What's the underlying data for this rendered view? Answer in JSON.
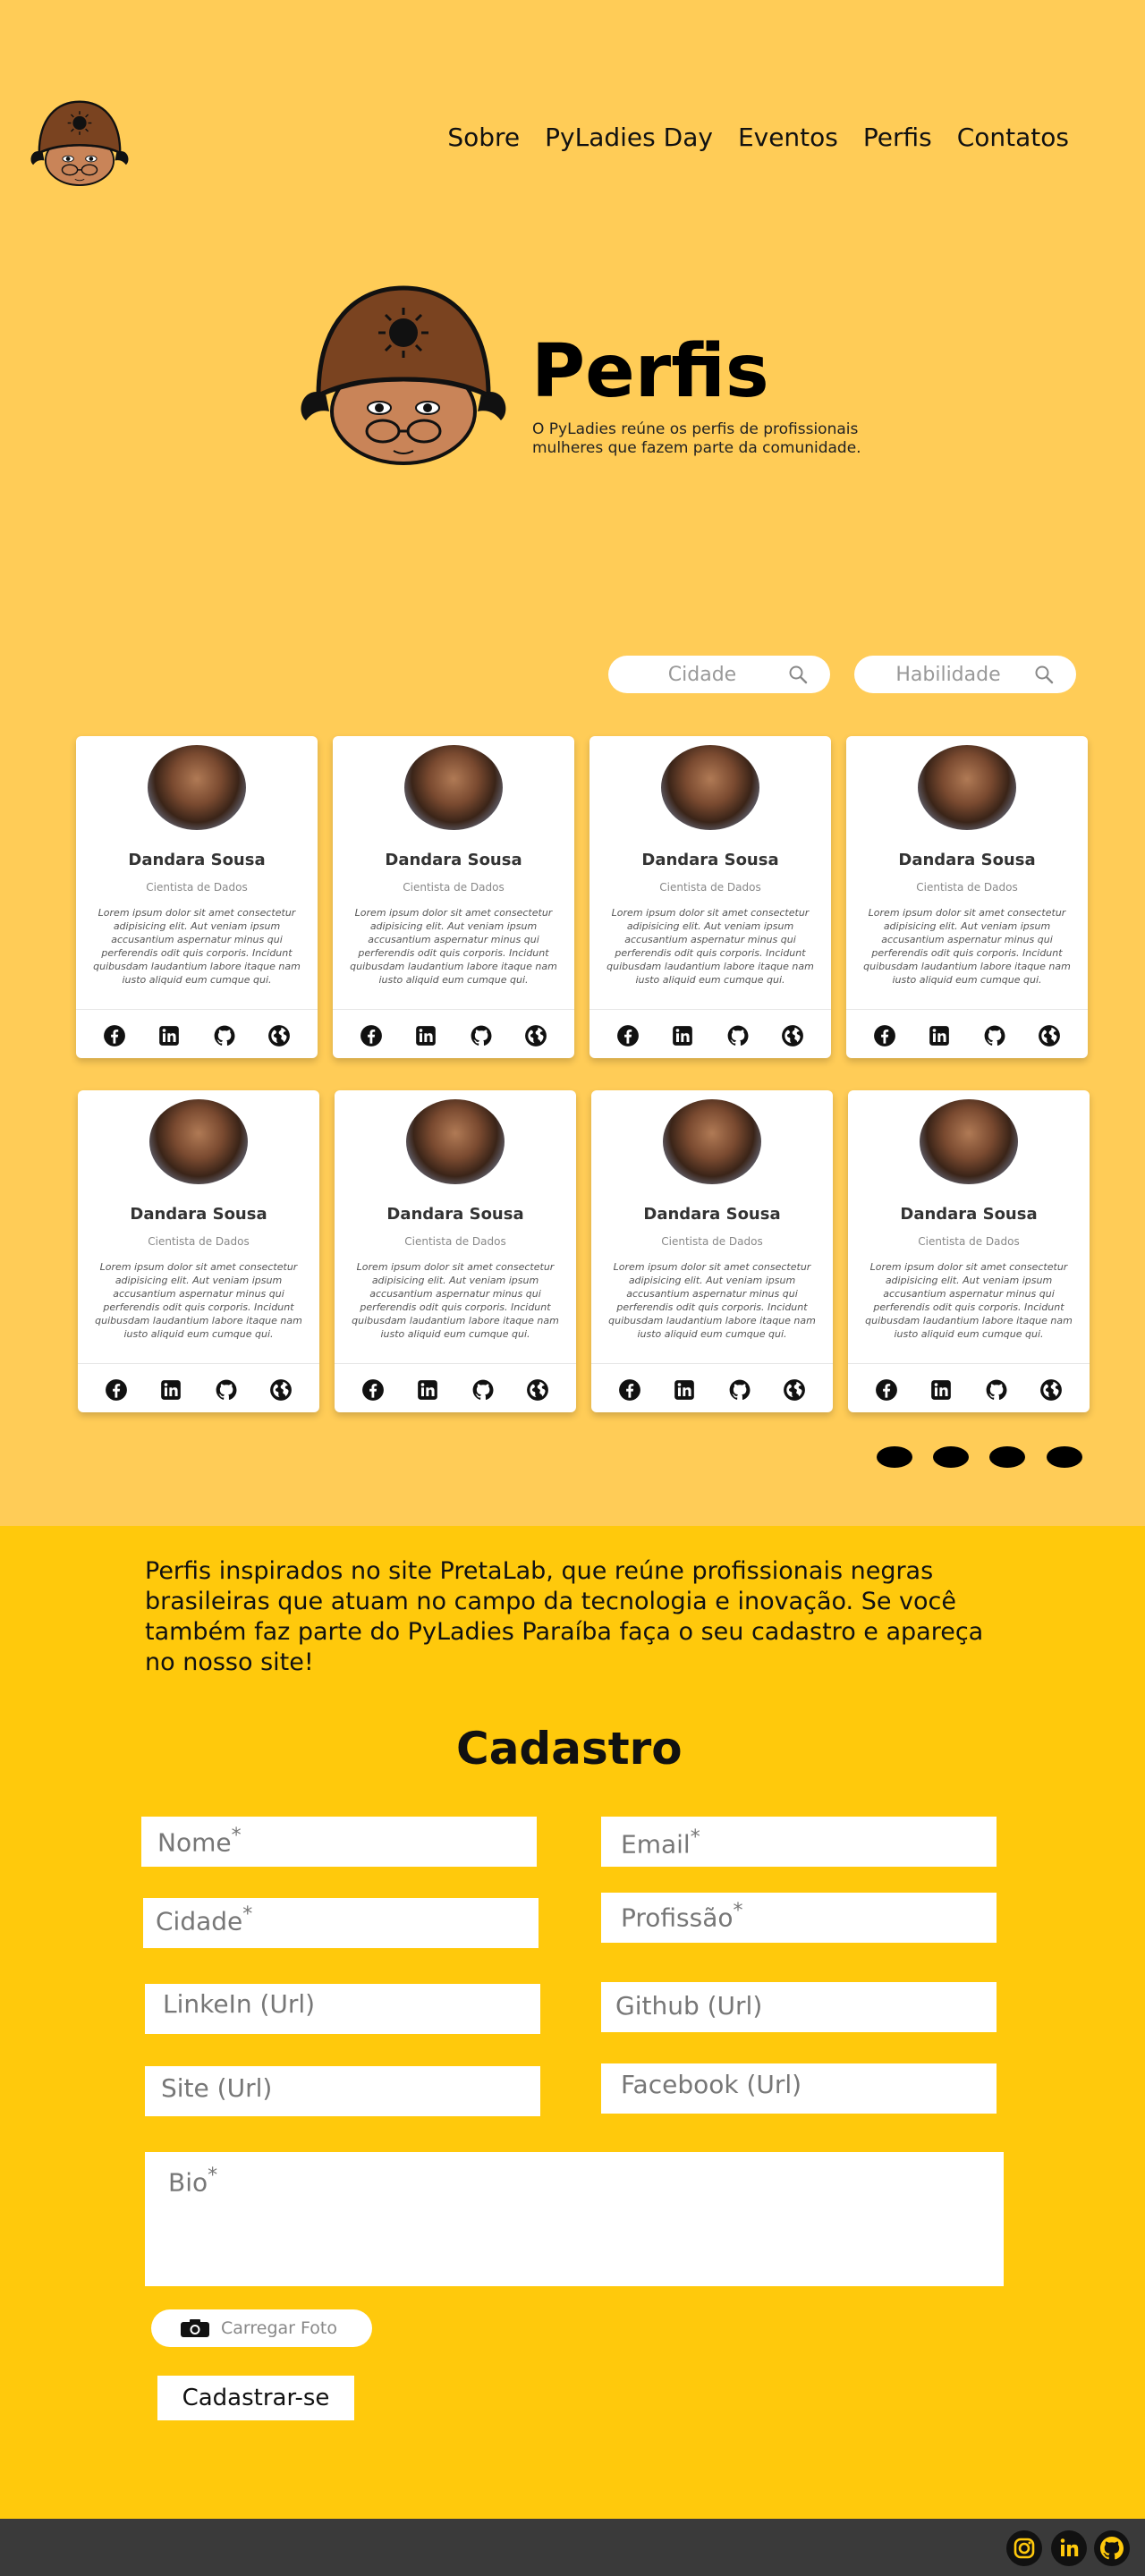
{
  "nav": {
    "items": [
      "Sobre",
      "PyLadies Day",
      "Eventos",
      "Perfis",
      "Contatos"
    ]
  },
  "hero": {
    "title": "Perfis",
    "subtitle": "O PyLadies reúne os perfis de profissionais mulheres que fazem parte da comunidade."
  },
  "filters": {
    "city_placeholder": "Cidade",
    "skill_placeholder": "Habilidade",
    "icon": "search-icon"
  },
  "profiles": [
    {
      "name": "Dandara Sousa",
      "role": "Cientista de Dados",
      "bio": "Lorem ipsum dolor sit amet consectetur adipisicing elit. Aut veniam ipsum accusantium aspernatur minus qui perferendis odit quis corporis. Incidunt quibusdam laudantium labore itaque nam iusto aliquid eum cumque qui."
    },
    {
      "name": "Dandara Sousa",
      "role": "Cientista de Dados",
      "bio": "Lorem ipsum dolor sit amet consectetur adipisicing elit. Aut veniam ipsum accusantium aspernatur minus qui perferendis odit quis corporis. Incidunt quibusdam laudantium labore itaque nam iusto aliquid eum cumque qui."
    },
    {
      "name": "Dandara Sousa",
      "role": "Cientista de Dados",
      "bio": "Lorem ipsum dolor sit amet consectetur adipisicing elit. Aut veniam ipsum accusantium aspernatur minus qui perferendis odit quis corporis. Incidunt quibusdam laudantium labore itaque nam iusto aliquid eum cumque qui."
    },
    {
      "name": "Dandara Sousa",
      "role": "Cientista de Dados",
      "bio": "Lorem ipsum dolor sit amet consectetur adipisicing elit. Aut veniam ipsum accusantium aspernatur minus qui perferendis odit quis corporis. Incidunt quibusdam laudantium labore itaque nam iusto aliquid eum cumque qui."
    },
    {
      "name": "Dandara Sousa",
      "role": "Cientista de Dados",
      "bio": "Lorem ipsum dolor sit amet consectetur adipisicing elit. Aut veniam ipsum accusantium aspernatur minus qui perferendis odit quis corporis. Incidunt quibusdam laudantium labore itaque nam iusto aliquid eum cumque qui."
    },
    {
      "name": "Dandara Sousa",
      "role": "Cientista de Dados",
      "bio": "Lorem ipsum dolor sit amet consectetur adipisicing elit. Aut veniam ipsum accusantium aspernatur minus qui perferendis odit quis corporis. Incidunt quibusdam laudantium labore itaque nam iusto aliquid eum cumque qui."
    },
    {
      "name": "Dandara Sousa",
      "role": "Cientista de Dados",
      "bio": "Lorem ipsum dolor sit amet consectetur adipisicing elit. Aut veniam ipsum accusantium aspernatur minus qui perferendis odit quis corporis. Incidunt quibusdam laudantium labore itaque nam iusto aliquid eum cumque qui."
    },
    {
      "name": "Dandara Sousa",
      "role": "Cientista de Dados",
      "bio": "Lorem ipsum dolor sit amet consectetur adipisicing elit. Aut veniam ipsum accusantium aspernatur minus qui perferendis odit quis corporis. Incidunt quibusdam laudantium labore itaque nam iusto aliquid eum cumque qui."
    }
  ],
  "card_social_icons": [
    "facebook-icon",
    "linkedin-icon",
    "github-icon",
    "globe-icon"
  ],
  "pagination": {
    "page_count": 4
  },
  "signup": {
    "intro": "Perfis inspirados no site PretaLab, que reúne profissionais negras brasileiras que atuam no campo da tecnologia e inovação. Se você também faz parte do PyLadies Paraíba faça o seu cadastro e apareça no nosso site!",
    "title": "Cadastro",
    "fields": {
      "nome": "Nome",
      "email": "Email",
      "cidade": "Cidade",
      "profissao": "Profissão",
      "linkedin": "LinkeIn (Url)",
      "github": "Github (Url)",
      "site": "Site (Url)",
      "facebook": "Facebook (Url)",
      "bio": "Bio"
    },
    "required_mark": "*",
    "upload_label": "Carregar Foto",
    "submit_label": "Cadastrar-se"
  },
  "footer": {
    "icons": [
      "instagram-icon",
      "linkedin-icon",
      "github-icon"
    ]
  },
  "colors": {
    "background": "#FFCC57",
    "signup_background": "#FFC90C",
    "footer_background": "#3A3A3A",
    "card_background": "#FFFFFF"
  }
}
